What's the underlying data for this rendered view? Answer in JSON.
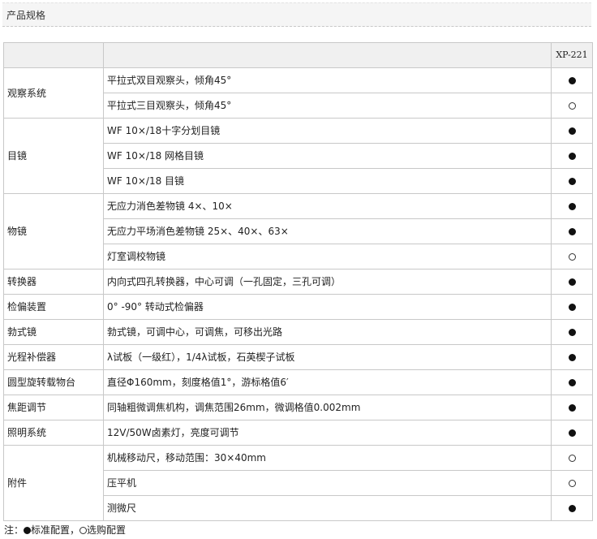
{
  "section_title": "产品规格",
  "table": {
    "header": {
      "category": "",
      "spec": "",
      "model": "XP-221"
    },
    "groups": [
      {
        "category": "观察系统",
        "rows": [
          {
            "spec": "平拉式双目观察头，倾角45°",
            "mark": "filled"
          },
          {
            "spec": "平拉式三目观察头，倾角45°",
            "mark": "open"
          }
        ]
      },
      {
        "category": "目镜",
        "rows": [
          {
            "spec": "WF 10×/18十字分划目镜",
            "mark": "filled"
          },
          {
            "spec": "WF 10×/18 网格目镜",
            "mark": "filled"
          },
          {
            "spec": "WF 10×/18 目镜",
            "mark": "filled"
          }
        ]
      },
      {
        "category": "物镜",
        "rows": [
          {
            "spec": "无应力消色差物镜 4×、10×",
            "mark": "filled"
          },
          {
            "spec": "无应力平场消色差物镜 25×、40×、63×",
            "mark": "filled"
          },
          {
            "spec": "灯室调校物镜",
            "mark": "open"
          }
        ]
      },
      {
        "category": "转换器",
        "rows": [
          {
            "spec": "内向式四孔转换器，中心可调（一孔固定，三孔可调）",
            "mark": "filled"
          }
        ]
      },
      {
        "category": "检偏装置",
        "rows": [
          {
            "spec": "0° -90° 转动式检偏器",
            "mark": "filled"
          }
        ]
      },
      {
        "category": "勃式镜",
        "rows": [
          {
            "spec": "勃式镜，可调中心，可调焦，可移出光路",
            "mark": "filled"
          }
        ]
      },
      {
        "category": "光程补偿器",
        "rows": [
          {
            "spec": "λ试板（一级红），1/4λ试板，石英楔子试板",
            "mark": "filled"
          }
        ]
      },
      {
        "category": "圆型旋转载物台",
        "rows": [
          {
            "spec": "直径Φ160mm，刻度格值1°，游标格值6′",
            "mark": "filled"
          }
        ]
      },
      {
        "category": "焦距调节",
        "rows": [
          {
            "spec": "同轴粗微调焦机构，调焦范围26mm，微调格值0.002mm",
            "mark": "filled"
          }
        ]
      },
      {
        "category": "照明系统",
        "rows": [
          {
            "spec": "12V/50W卤素灯，亮度可调节",
            "mark": "filled"
          }
        ]
      },
      {
        "category": "附件",
        "rows": [
          {
            "spec": "机械移动尺，移动范围：30×40mm",
            "mark": "open"
          },
          {
            "spec": "压平机",
            "mark": "open"
          },
          {
            "spec": "测微尺",
            "mark": "filled"
          }
        ]
      }
    ]
  },
  "legend": {
    "prefix": "注：",
    "standard": "标准配置，",
    "optional": "选购配置"
  }
}
